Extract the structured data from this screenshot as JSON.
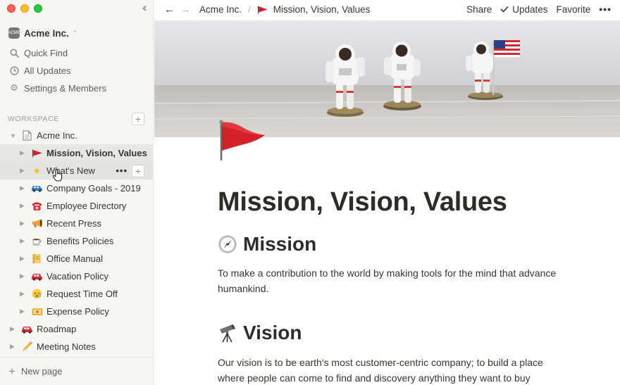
{
  "window": {
    "controls": [
      "close",
      "minimize",
      "zoom"
    ],
    "collapse_icon": "double-chevron-left-icon"
  },
  "sidebar": {
    "workspace_name": "Acme Inc.",
    "workspace_logo_text": "ACME",
    "menu": [
      {
        "label": "Quick Find",
        "icon": "search-icon"
      },
      {
        "label": "All Updates",
        "icon": "clock-icon"
      },
      {
        "label": "Settings & Members",
        "icon": "gear-icon"
      }
    ],
    "section_label": "WORKSPACE",
    "tree": [
      {
        "label": "Acme Inc.",
        "icon": "page-icon",
        "level": 0,
        "expanded": true
      },
      {
        "label": "Mission, Vision, Values",
        "icon": "red-flag",
        "level": 1,
        "active": true
      },
      {
        "label": "What's New",
        "icon": "star",
        "level": 1,
        "hover": true
      },
      {
        "label": "Company Goals - 2019",
        "icon": "car",
        "level": 1
      },
      {
        "label": "Employee Directory",
        "icon": "telephone",
        "level": 1
      },
      {
        "label": "Recent Press",
        "icon": "megaphone",
        "level": 1
      },
      {
        "label": "Benefits Policies",
        "icon": "coffee",
        "level": 1
      },
      {
        "label": "Office Manual",
        "icon": "scroll",
        "level": 1
      },
      {
        "label": "Vacation Policy",
        "icon": "car",
        "level": 1
      },
      {
        "label": "Request Time Off",
        "icon": "sleepy-face",
        "level": 1
      },
      {
        "label": "Expense Policy",
        "icon": "ticket",
        "level": 1
      },
      {
        "label": "Roadmap",
        "icon": "car",
        "level": 0
      },
      {
        "label": "Meeting Notes",
        "icon": "pencil",
        "level": 0
      }
    ],
    "new_page_label": "New page"
  },
  "topbar": {
    "breadcrumb_root": "Acme Inc.",
    "breadcrumb_separator": "/",
    "breadcrumb_current": "Mission, Vision, Values",
    "share_label": "Share",
    "updates_label": "Updates",
    "favorite_label": "Favorite",
    "more_label": "•••"
  },
  "page": {
    "title": "Mission, Vision, Values",
    "sections": [
      {
        "heading": "Mission",
        "icon": "compass-icon",
        "text": "To make a contribution to the world by making tools for the mind that advance humankind."
      },
      {
        "heading": "Vision",
        "icon": "telescope-icon",
        "text": "Our vision is to be earth's most customer-centric company; to build a place where people can come to find and discovery anything they want to buy"
      }
    ]
  },
  "colors": {
    "sidebar_bg": "#f7f6f3",
    "text": "#37352f",
    "muted": "#9b9a97",
    "flag_red": "#d4202a"
  }
}
